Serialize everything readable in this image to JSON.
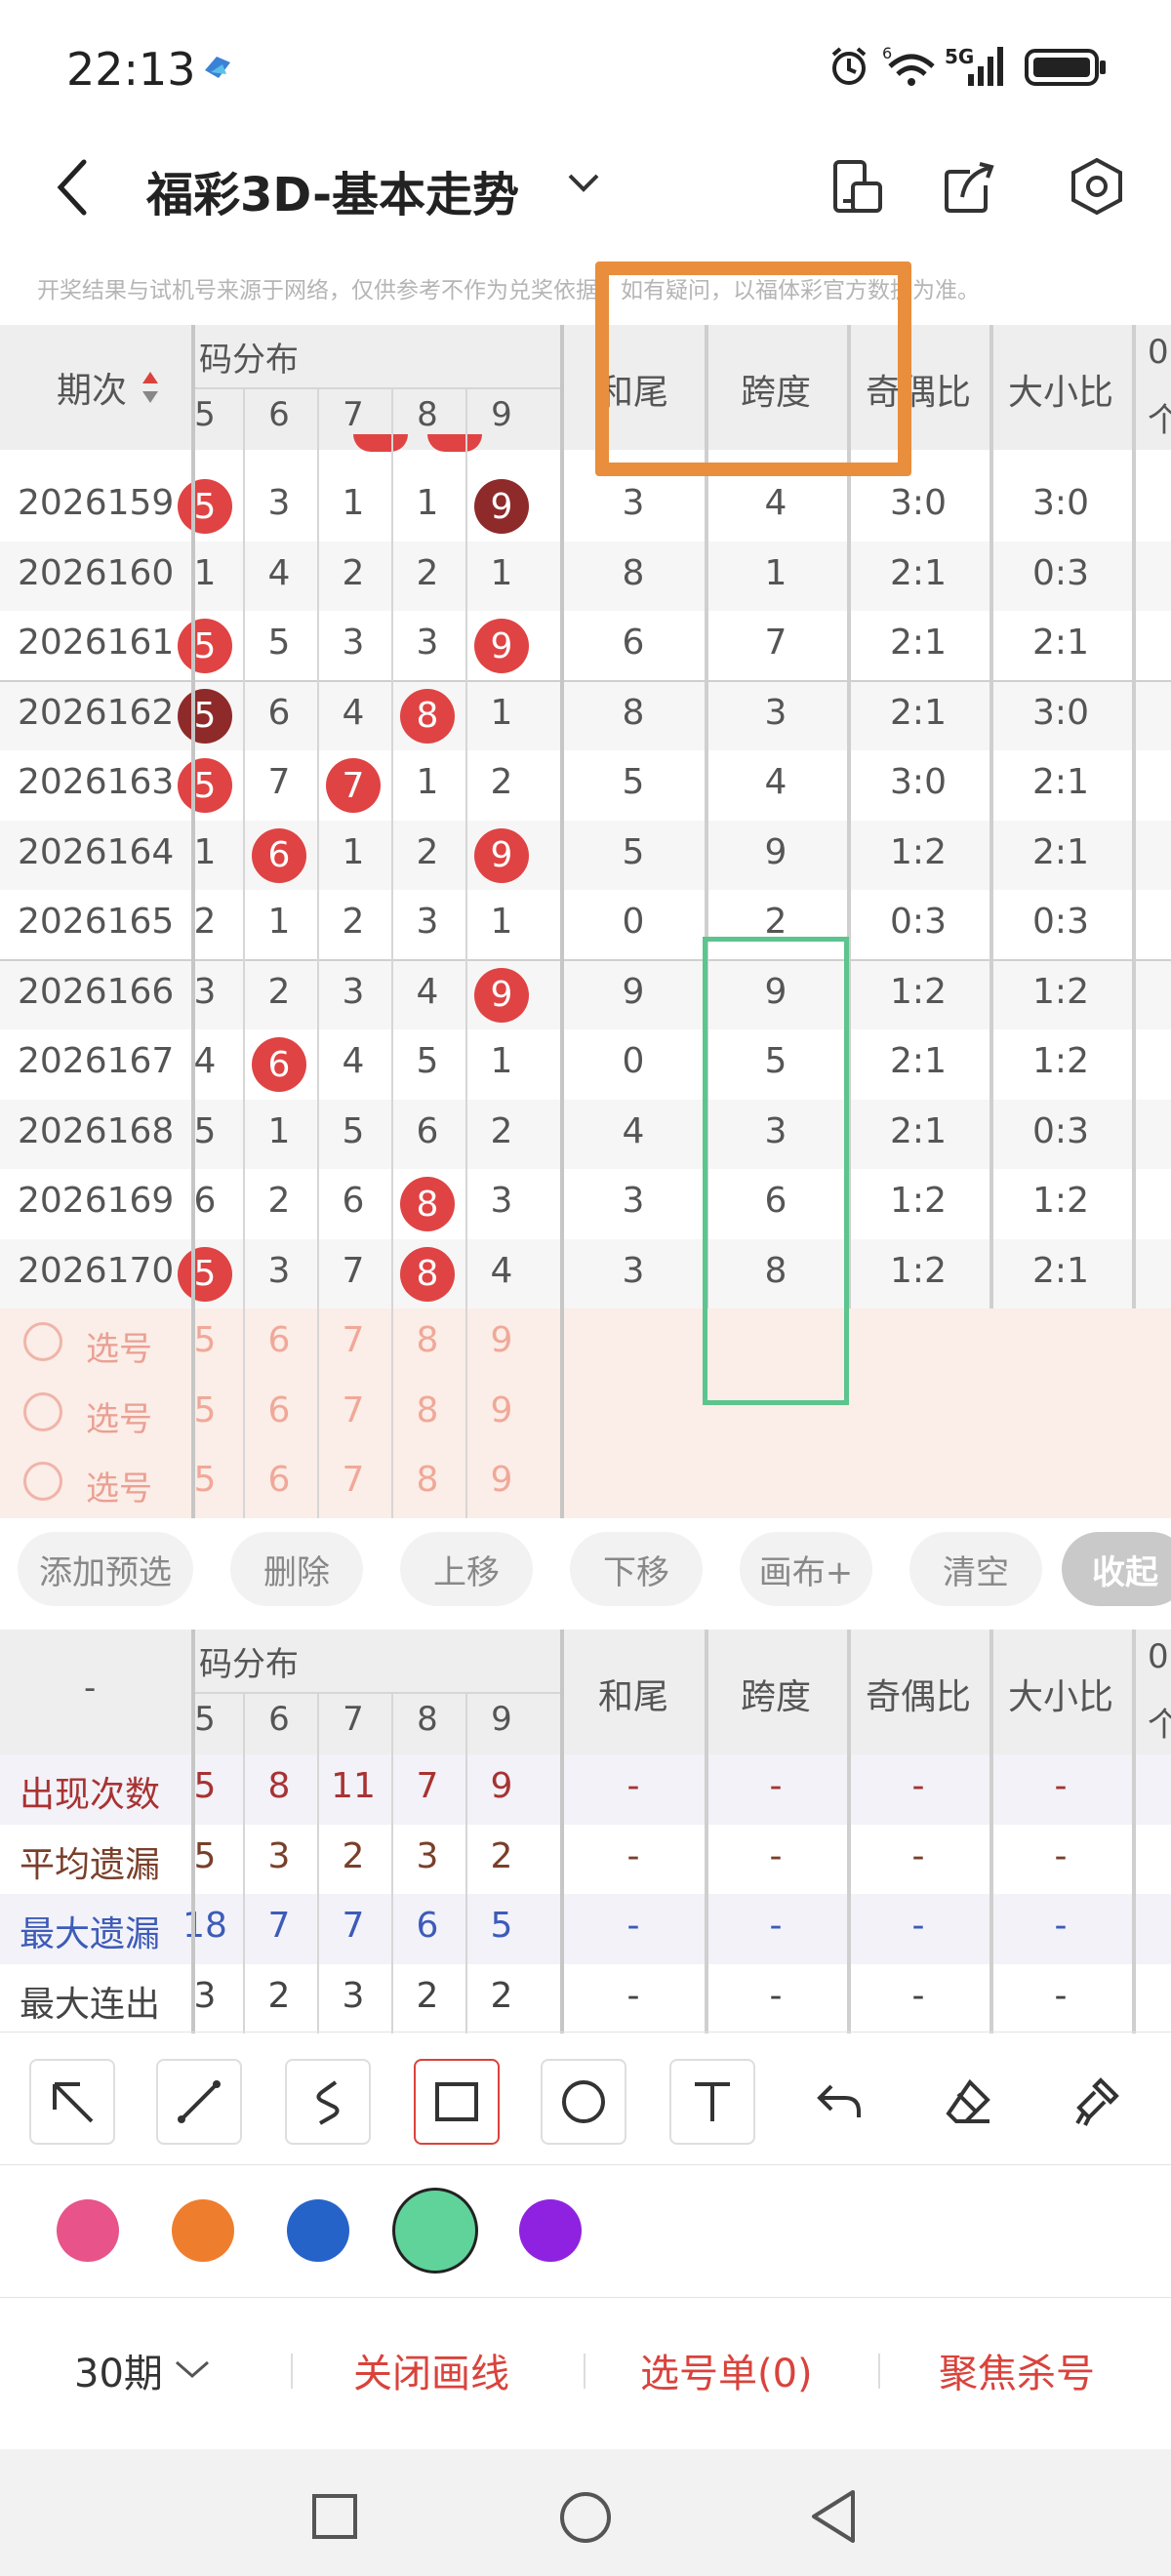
{
  "status_bar": {
    "time": "22:13",
    "signal_label": "5G"
  },
  "header": {
    "title": "福彩3D-基本走势",
    "back_icon": "chevron-left-icon",
    "dropdown_icon": "chevron-down-icon",
    "tools": [
      "phone-switch-icon",
      "share-icon",
      "settings-hex-icon"
    ]
  },
  "notice": "开奖结果与试机号来源于网络，仅供参考不作为兑奖依据。如有疑问，以福体彩官方数据为准。",
  "trend_table": {
    "col_period": "期次",
    "group_label": "码分布",
    "digits": [
      "5",
      "6",
      "7",
      "8",
      "9"
    ],
    "stat_cols": [
      "和尾",
      "跨度",
      "奇偶比",
      "大小比"
    ],
    "extra_col_top": "0",
    "extra_col_bottom": "个",
    "rows": [
      {
        "period": "2026159",
        "d": [
          "5",
          "3",
          "1",
          "1",
          "9"
        ],
        "hit": [
          1,
          0,
          0,
          0,
          2
        ],
        "hw": "3",
        "kd": "4",
        "jo": "3:0",
        "dx": "3:0"
      },
      {
        "period": "2026160",
        "d": [
          "1",
          "4",
          "2",
          "2",
          "1"
        ],
        "hit": [
          0,
          0,
          0,
          0,
          0
        ],
        "hw": "8",
        "kd": "1",
        "jo": "2:1",
        "dx": "0:3"
      },
      {
        "period": "2026161",
        "d": [
          "5",
          "5",
          "3",
          "3",
          "9"
        ],
        "hit": [
          1,
          0,
          0,
          0,
          1
        ],
        "hw": "6",
        "kd": "7",
        "jo": "2:1",
        "dx": "2:1"
      },
      {
        "period": "2026162",
        "d": [
          "5",
          "6",
          "4",
          "8",
          "1"
        ],
        "hit": [
          2,
          0,
          0,
          1,
          0
        ],
        "hw": "8",
        "kd": "3",
        "jo": "2:1",
        "dx": "3:0"
      },
      {
        "period": "2026163",
        "d": [
          "5",
          "7",
          "7",
          "1",
          "2"
        ],
        "hit": [
          1,
          0,
          1,
          0,
          0
        ],
        "hw": "5",
        "kd": "4",
        "jo": "3:0",
        "dx": "2:1"
      },
      {
        "period": "2026164",
        "d": [
          "1",
          "6",
          "1",
          "2",
          "9"
        ],
        "hit": [
          0,
          1,
          0,
          0,
          1
        ],
        "hw": "5",
        "kd": "9",
        "jo": "1:2",
        "dx": "2:1"
      },
      {
        "period": "2026165",
        "d": [
          "2",
          "1",
          "2",
          "3",
          "1"
        ],
        "hit": [
          0,
          0,
          0,
          0,
          0
        ],
        "hw": "0",
        "kd": "2",
        "jo": "0:3",
        "dx": "0:3"
      },
      {
        "period": "2026166",
        "d": [
          "3",
          "2",
          "3",
          "4",
          "9"
        ],
        "hit": [
          0,
          0,
          0,
          0,
          1
        ],
        "hw": "9",
        "kd": "9",
        "jo": "1:2",
        "dx": "1:2"
      },
      {
        "period": "2026167",
        "d": [
          "4",
          "6",
          "4",
          "5",
          "1"
        ],
        "hit": [
          0,
          1,
          0,
          0,
          0
        ],
        "hw": "0",
        "kd": "5",
        "jo": "2:1",
        "dx": "1:2"
      },
      {
        "period": "2026168",
        "d": [
          "5",
          "1",
          "5",
          "6",
          "2"
        ],
        "hit": [
          0,
          0,
          0,
          0,
          0
        ],
        "hw": "4",
        "kd": "3",
        "jo": "2:1",
        "dx": "0:3"
      },
      {
        "period": "2026169",
        "d": [
          "6",
          "2",
          "6",
          "8",
          "3"
        ],
        "hit": [
          0,
          0,
          0,
          1,
          0
        ],
        "hw": "3",
        "kd": "6",
        "jo": "1:2",
        "dx": "1:2"
      },
      {
        "period": "2026170",
        "d": [
          "5",
          "3",
          "7",
          "8",
          "4"
        ],
        "hit": [
          1,
          0,
          0,
          1,
          0
        ],
        "hw": "3",
        "kd": "8",
        "jo": "1:2",
        "dx": "2:1"
      }
    ],
    "pick_rows": [
      {
        "label": "选号",
        "d": [
          "5",
          "6",
          "7",
          "8",
          "9"
        ]
      },
      {
        "label": "选号",
        "d": [
          "5",
          "6",
          "7",
          "8",
          "9"
        ]
      },
      {
        "label": "选号",
        "d": [
          "5",
          "6",
          "7",
          "8",
          "9"
        ]
      }
    ]
  },
  "action_bar": {
    "buttons": [
      "添加预选",
      "删除",
      "上移",
      "下移",
      "画布+",
      "清空"
    ],
    "collapse": "收起"
  },
  "stats_table": {
    "col_label": "-",
    "group_label": "码分布",
    "digits": [
      "5",
      "6",
      "7",
      "8",
      "9"
    ],
    "stat_cols": [
      "和尾",
      "跨度",
      "奇偶比",
      "大小比"
    ],
    "extra_col_top": "0",
    "extra_col_bottom": "个",
    "rows": [
      {
        "label": "出现次数",
        "color": "#a83232",
        "vals": [
          "5",
          "8",
          "11",
          "7",
          "9"
        ],
        "dash": "-"
      },
      {
        "label": "平均遗漏",
        "color": "#7a3f2a",
        "vals": [
          "5",
          "3",
          "2",
          "3",
          "2"
        ],
        "dash": "-"
      },
      {
        "label": "最大遗漏",
        "color": "#3d5bb8",
        "vals": [
          "18",
          "7",
          "7",
          "6",
          "5"
        ],
        "dash": "-"
      },
      {
        "label": "最大连出",
        "color": "#444444",
        "vals": [
          "3",
          "2",
          "3",
          "2",
          "2"
        ],
        "dash": "-"
      }
    ]
  },
  "draw_tools": [
    "arrow-icon",
    "line-icon",
    "curve-icon",
    "rectangle-icon",
    "circle-icon",
    "text-icon",
    "undo-icon",
    "eraser-icon",
    "brush-clear-icon"
  ],
  "selected_tool": "rectangle-icon",
  "colors": [
    "#e8538a",
    "#ef7d2e",
    "#2563c9",
    "#5fd39a",
    "#8f22e0"
  ],
  "selected_color": "#5fd39a",
  "annotations": {
    "orange_rect": "#e98e3c",
    "green_rect": "#5cc48e"
  },
  "footer": {
    "period_select": "30期",
    "close_lines": "关闭画线",
    "pick_list": "选号单(0)",
    "focus_kill": "聚焦杀号"
  }
}
